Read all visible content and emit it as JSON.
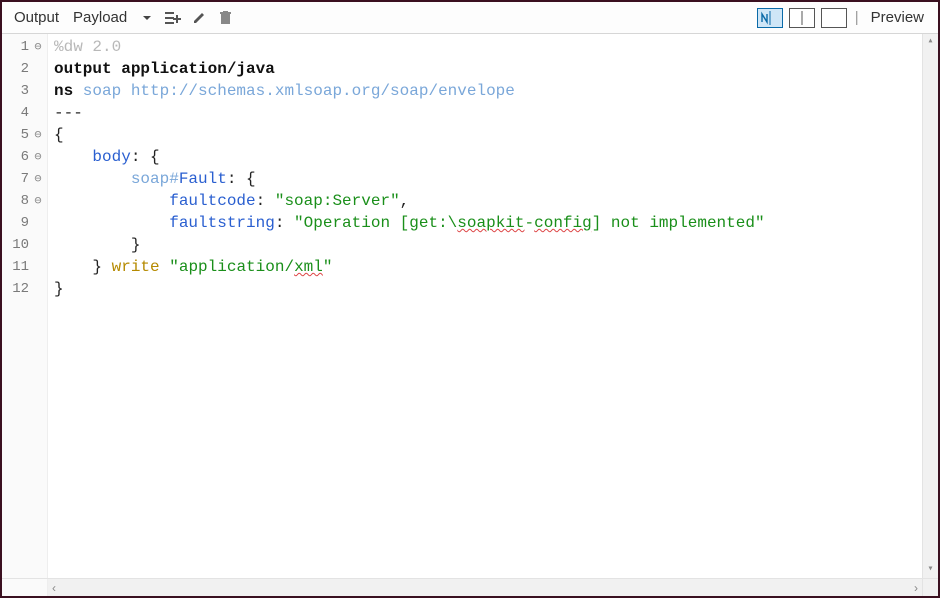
{
  "toolbar": {
    "output_label": "Output",
    "payload_label": "Payload",
    "preview_label": "Preview",
    "icons": {
      "dropdown": "chevron-down",
      "add_list": "list-add",
      "edit": "pencil",
      "delete": "trash"
    },
    "view_modes": {
      "active": 0,
      "modes": [
        "split-with-n",
        "split",
        "single"
      ]
    }
  },
  "editor": {
    "lines": [
      {
        "n": 1,
        "fold": true,
        "segments": [
          {
            "t": "%dw 2.0",
            "c": "c-gray"
          }
        ]
      },
      {
        "n": 2,
        "fold": false,
        "segments": [
          {
            "t": "output",
            "c": "c-kw"
          },
          {
            "t": " application/java",
            "c": "c-kw"
          }
        ]
      },
      {
        "n": 3,
        "fold": false,
        "segments": [
          {
            "t": "ns",
            "c": "c-kw"
          },
          {
            "t": " soap http://schemas.xmlsoap.org/soap/envelope",
            "c": "c-ns"
          }
        ]
      },
      {
        "n": 4,
        "fold": false,
        "segments": [
          {
            "t": "---",
            "c": ""
          }
        ]
      },
      {
        "n": 5,
        "fold": true,
        "segments": [
          {
            "t": "{",
            "c": ""
          }
        ]
      },
      {
        "n": 6,
        "fold": true,
        "segments": [
          {
            "t": "    ",
            "c": ""
          },
          {
            "t": "body",
            "c": "c-key"
          },
          {
            "t": ": {",
            "c": ""
          }
        ]
      },
      {
        "n": 7,
        "fold": true,
        "segments": [
          {
            "t": "        ",
            "c": ""
          },
          {
            "t": "soap#",
            "c": "c-ns"
          },
          {
            "t": "Fault",
            "c": "c-key"
          },
          {
            "t": ": {",
            "c": ""
          }
        ]
      },
      {
        "n": 8,
        "fold": true,
        "segments": [
          {
            "t": "            ",
            "c": ""
          },
          {
            "t": "faultcode",
            "c": "c-key"
          },
          {
            "t": ": ",
            "c": ""
          },
          {
            "t": "\"soap:Server\"",
            "c": "c-str"
          },
          {
            "t": ",",
            "c": ""
          }
        ]
      },
      {
        "n": 9,
        "fold": false,
        "segments": [
          {
            "t": "            ",
            "c": ""
          },
          {
            "t": "faultstring",
            "c": "c-key"
          },
          {
            "t": ": ",
            "c": ""
          },
          {
            "t": "\"Operation [get:\\",
            "c": "c-str"
          },
          {
            "t": "soapkit",
            "c": "c-str squig"
          },
          {
            "t": "-",
            "c": "c-str"
          },
          {
            "t": "config",
            "c": "c-str squig"
          },
          {
            "t": "] not implemented\"",
            "c": "c-str"
          }
        ]
      },
      {
        "n": 10,
        "fold": false,
        "segments": [
          {
            "t": "        }",
            "c": ""
          }
        ]
      },
      {
        "n": 11,
        "fold": false,
        "segments": [
          {
            "t": "    } ",
            "c": ""
          },
          {
            "t": "write",
            "c": "c-write"
          },
          {
            "t": " ",
            "c": ""
          },
          {
            "t": "\"application/",
            "c": "c-str"
          },
          {
            "t": "xml",
            "c": "c-str squig"
          },
          {
            "t": "\"",
            "c": "c-str"
          }
        ]
      },
      {
        "n": 12,
        "fold": false,
        "segments": [
          {
            "t": "}",
            "c": ""
          }
        ]
      }
    ]
  }
}
